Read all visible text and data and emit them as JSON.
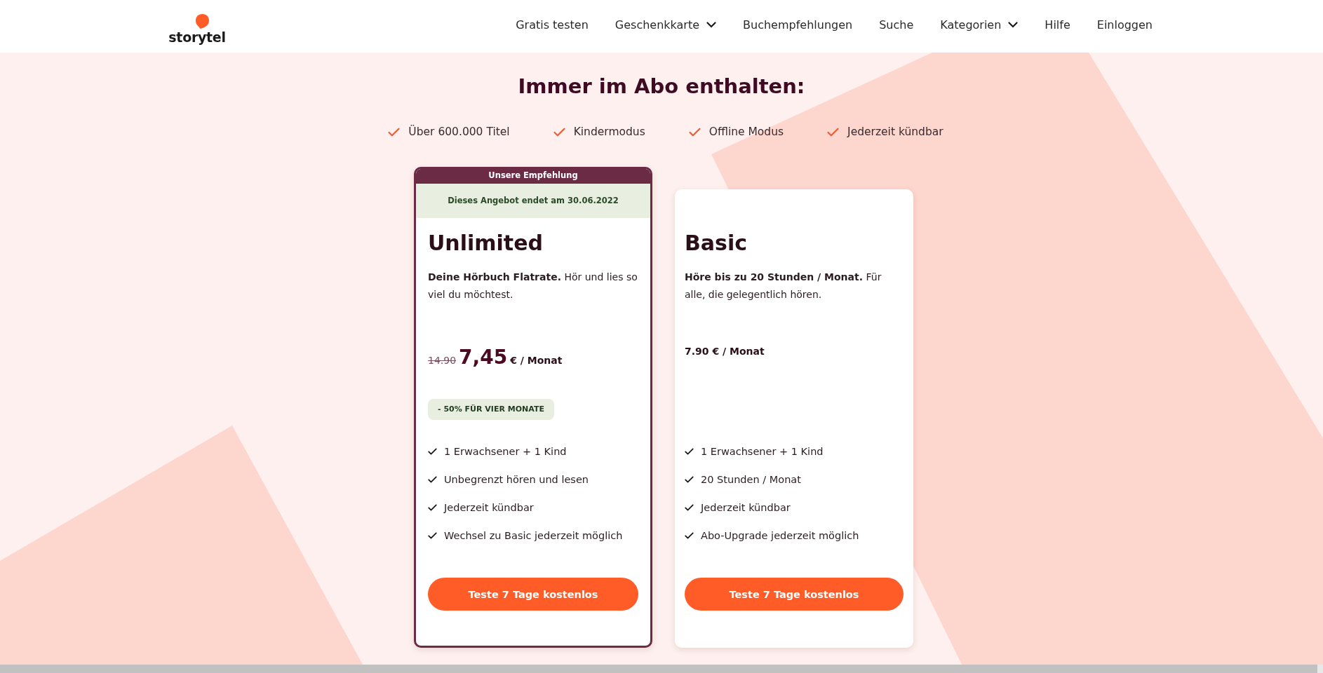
{
  "header": {
    "logo": "storytel",
    "nav": [
      {
        "label": "Gratis testen",
        "dropdown": false
      },
      {
        "label": "Geschenkkarte",
        "dropdown": true
      },
      {
        "label": "Buchempfehlungen",
        "dropdown": false
      },
      {
        "label": "Suche",
        "dropdown": false
      },
      {
        "label": "Kategorien",
        "dropdown": true
      },
      {
        "label": "Hilfe",
        "dropdown": false
      },
      {
        "label": "Einloggen",
        "dropdown": false
      }
    ]
  },
  "section": {
    "title": "Immer im Abo enthalten:",
    "features": [
      "Über 600.000 Titel",
      "Kindermodus",
      "Offline Modus",
      "Jederzeit kündbar"
    ]
  },
  "plans": [
    {
      "featured": true,
      "ribbon": "Unsere Empfehlung",
      "offer": "Dieses Angebot endet am 30.06.2022",
      "name": "Unlimited",
      "description": "**Deine Hörbuch Flatrate.** Hör und lies so viel du möchtest.",
      "old_price": "14.90",
      "price": "7,45",
      "unit": "€ / Monat",
      "discount": "- 50% FÜR VIER MONATE",
      "features": [
        "1 Erwachsener + 1 Kind",
        "Unbegrenzt hören und lesen",
        "Jederzeit kündbar",
        "Wechsel zu Basic jederzeit möglich"
      ],
      "button": "Teste 7 Tage kostenlos"
    },
    {
      "featured": false,
      "name": "Basic",
      "description": "**Höre bis zu 20 Stunden / Monat.** Für alle, die gelegentlich hören.",
      "price": "7.90 € / Monat",
      "features": [
        "1 Erwachsener + 1 Kind",
        "20 Stunden / Monat",
        "Jederzeit kündbar",
        "Abo-Upgrade jederzeit möglich"
      ],
      "button": "Teste 7 Tage kostenlos"
    }
  ]
}
